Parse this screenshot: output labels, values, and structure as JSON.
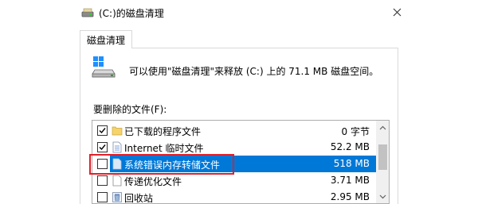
{
  "window": {
    "title": "(C:)的磁盘清理"
  },
  "tab": {
    "label": "磁盘清理"
  },
  "summary": {
    "text": "可以使用\"磁盘清理\"来释放 (C:) 上的 71.1 MB 磁盘空间。"
  },
  "files_label": "要删除的文件(F):",
  "files": [
    {
      "name": "已下载的程序文件",
      "size": "0 字节",
      "checked": true,
      "icon": "folder-icon"
    },
    {
      "name": "Internet 临时文件",
      "size": "52.2 MB",
      "checked": true,
      "icon": "document-icon"
    },
    {
      "name": "系统错误内存转储文件",
      "size": "518 MB",
      "checked": false,
      "icon": "document-icon",
      "selected": true
    },
    {
      "name": "传递优化文件",
      "size": "3.71 MB",
      "checked": false,
      "icon": "document-icon"
    },
    {
      "name": "回收站",
      "size": "2.95 MB",
      "checked": false,
      "icon": "recycle-bin-icon"
    }
  ],
  "colors": {
    "selection": "#0078d7",
    "annotation": "#e0202a"
  }
}
